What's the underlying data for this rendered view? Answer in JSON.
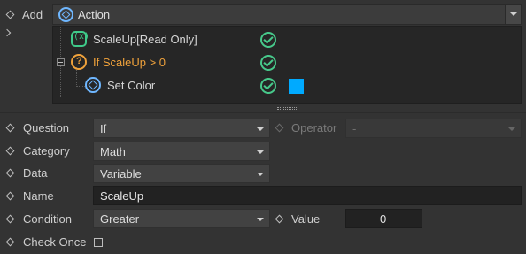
{
  "add_row": {
    "label": "Add",
    "action": "Action"
  },
  "tree": [
    {
      "text": "ScaleUp[Read Only]",
      "icon": "variable-icon",
      "status": "valid"
    },
    {
      "text": "If ScaleUp > 0",
      "icon": "condition-icon",
      "status": "valid"
    },
    {
      "text": "Set Color",
      "icon": "action-icon",
      "status": "valid",
      "swatch": "#00aaff"
    }
  ],
  "colors": {
    "accent_green": "#47c98b",
    "condition_orange": "#f0a23b",
    "swatch": "#00aaff"
  },
  "properties": {
    "question": {
      "label": "Question",
      "value": "If"
    },
    "operator": {
      "label": "Operator",
      "value": "-"
    },
    "category": {
      "label": "Category",
      "value": "Math"
    },
    "data": {
      "label": "Data",
      "value": "Variable"
    },
    "name": {
      "label": "Name",
      "value": "ScaleUp"
    },
    "condition": {
      "label": "Condition",
      "value": "Greater"
    },
    "value": {
      "label": "Value",
      "value": "0"
    },
    "check_once": {
      "label": "Check Once",
      "checked": false
    }
  }
}
